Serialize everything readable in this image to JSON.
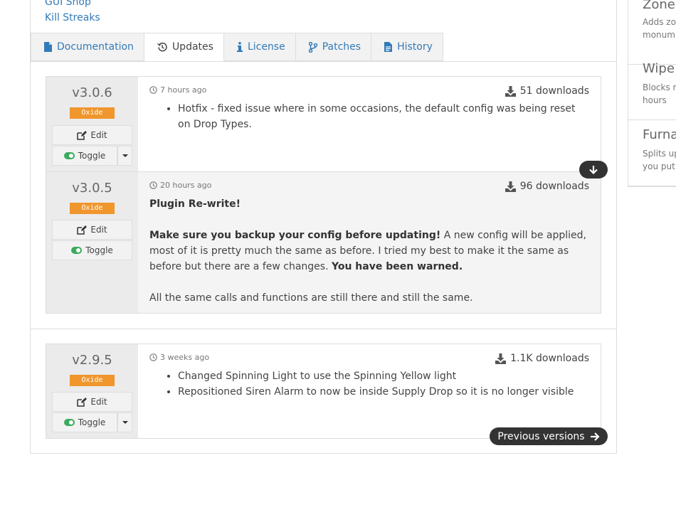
{
  "top_links": [
    "GUI Shop",
    "Kill Streaks"
  ],
  "tabs": [
    {
      "label": "Documentation",
      "icon": "file-icon"
    },
    {
      "label": "Updates",
      "icon": "history-icon"
    },
    {
      "label": "License",
      "icon": "info-icon"
    },
    {
      "label": "Patches",
      "icon": "branch-icon"
    },
    {
      "label": "History",
      "icon": "file-text-icon"
    }
  ],
  "actions": {
    "edit": "Edit",
    "toggle": "Toggle"
  },
  "versions": [
    {
      "number": "v3.0.6",
      "badge": "Oxide",
      "time": "7 hours ago",
      "downloads": "51 downloads",
      "bullets": [
        "Hotfix - fixed issue where in some occasions, the default config was being reset on Drop Types."
      ]
    },
    {
      "number": "v3.0.5",
      "badge": "Oxide",
      "time": "20 hours ago",
      "downloads": "96 downloads",
      "heading": "Plugin Re-write!",
      "warn_bold": "Make sure you backup your config before updating!",
      "warn_text": " A new config will be applied, most of it is pretty much the same as before. I tried my best to make it the same as before but there are a few changes. ",
      "warn_end": "You have been warned.",
      "closing": "All the same calls and functions are still there and still the same."
    },
    {
      "number": "v2.9.5",
      "badge": "Oxide",
      "time": "3 weeks ago",
      "downloads": "1.1K downloads",
      "bullets": [
        "Changed Spinning Light to use the Spinning Yellow light",
        "Repositioned Siren Alarm to now be inside Supply Drop so it is no longer visible"
      ]
    }
  ],
  "previous_versions": "Previous versions",
  "sidebar": [
    {
      "title": "Zone",
      "lines": [
        "Adds zo",
        "monum"
      ]
    },
    {
      "title": "Wipe",
      "lines": [
        "Blocks ra",
        "hours"
      ]
    },
    {
      "title": "Furna",
      "lines": [
        "Splits up",
        "you put"
      ]
    }
  ],
  "colors": {
    "link": "#337ab7",
    "badge": "#f0962c",
    "toggle": "#3aaa5c",
    "dark_button": "#333333"
  }
}
